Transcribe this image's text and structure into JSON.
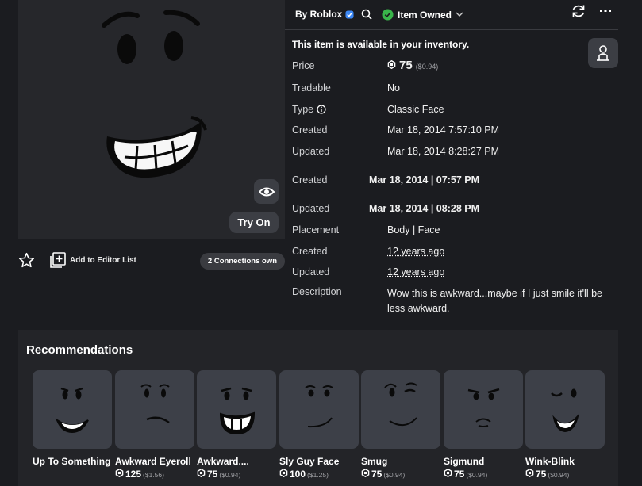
{
  "preview": {
    "try_on_label": "Try On"
  },
  "actions": {
    "add_to_list_label": "Add to Editor List",
    "connections_label": "2 Connections own"
  },
  "header": {
    "by_label": "By Roblox",
    "owned_label": "Item Owned"
  },
  "details": {
    "availability": "This item is available in your inventory.",
    "price_label": "Price",
    "price_value": "75",
    "price_usd": "($0.94)",
    "rows": [
      {
        "label": "Tradable",
        "value": "No"
      },
      {
        "label": "Type",
        "value": "Classic Face"
      },
      {
        "label": "Created",
        "value": "Mar 18, 2014 7:57:10 PM"
      },
      {
        "label": "Updated",
        "value": "Mar 18, 2014 8:28:27 PM"
      },
      {
        "label": "Created",
        "value": "Mar 18, 2014 | 07:57 PM"
      },
      {
        "label": "Updated",
        "value": "Mar 18, 2014 | 08:28 PM"
      },
      {
        "label": "Placement",
        "value": "Body | Face"
      },
      {
        "label": "Created",
        "value": "12 years ago"
      },
      {
        "label": "Updated",
        "value": "12 years ago"
      },
      {
        "label": "Description",
        "value": "Wow this is awkward...maybe if I just smile it'll be less awkward."
      }
    ]
  },
  "recommendations": {
    "title": "Recommendations",
    "items": [
      {
        "name": "Up To Something",
        "price": "",
        "usd": ""
      },
      {
        "name": "Awkward Eyeroll",
        "price": "125",
        "usd": "($1.56)"
      },
      {
        "name": "Awkward....",
        "price": "75",
        "usd": "($0.94)"
      },
      {
        "name": "Sly Guy Face",
        "price": "100",
        "usd": "($1.25)"
      },
      {
        "name": "Smug",
        "price": "75",
        "usd": "($0.94)"
      },
      {
        "name": "Sigmund",
        "price": "75",
        "usd": "($0.94)"
      },
      {
        "name": "Wink-Blink",
        "price": "75",
        "usd": "($0.94)"
      }
    ]
  },
  "colors": {
    "background": "#1b1c20",
    "panel": "#232428",
    "thumb": "#3d4048",
    "verified": "#3c88f6",
    "owned": "#39b54a"
  },
  "icons": [
    "eye-icon",
    "star-icon",
    "add-list-icon",
    "verified-icon",
    "search-icon",
    "check-circle-icon",
    "chevron-down-icon",
    "refresh-icon",
    "more-icon",
    "avatar-icon",
    "info-icon",
    "robux-icon"
  ]
}
